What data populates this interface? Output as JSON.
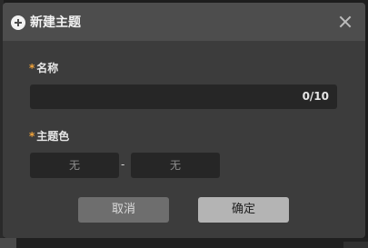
{
  "dialog": {
    "title": "新建主题",
    "header_icon": "plus-circle-icon",
    "close_icon": "close-icon"
  },
  "form": {
    "required_marker": "*",
    "name": {
      "label": "名称",
      "value": "",
      "counter": "0/10"
    },
    "theme_color": {
      "label": "主题色",
      "start_value": "无",
      "separator": "-",
      "end_value": "无"
    }
  },
  "actions": {
    "cancel_label": "取消",
    "confirm_label": "确定"
  },
  "colors": {
    "required_star": "#f1a33a",
    "dialog_bg": "#3c3c3c",
    "header_bg": "#4d4d4d",
    "input_bg": "#262626"
  }
}
